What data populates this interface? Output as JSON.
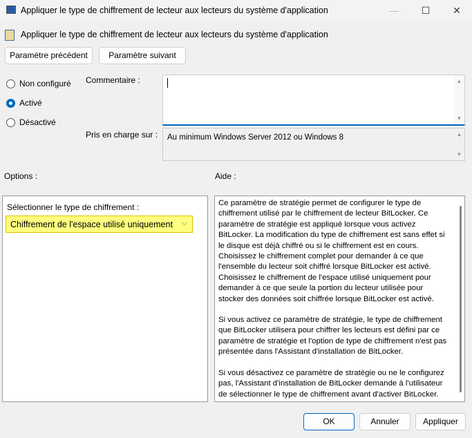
{
  "window": {
    "title": "Appliquer le type de chiffrement de lecteur aux lecteurs du système d'application",
    "minimize": "—",
    "maximize": "☐",
    "close": "✕"
  },
  "header": {
    "title": "Appliquer le type de chiffrement de lecteur aux lecteurs du système d'application"
  },
  "nav": {
    "previous": "Paramètre précédent",
    "next": "Paramètre suivant"
  },
  "state": {
    "options": [
      {
        "label": "Non configuré",
        "selected": false
      },
      {
        "label": "Activé",
        "selected": true
      },
      {
        "label": "Désactivé",
        "selected": false
      }
    ]
  },
  "comment": {
    "label": "Commentaire :",
    "value": ""
  },
  "supported": {
    "label": "Pris en charge sur :",
    "value": "Au minimum Windows Server 2012 ou Windows 8"
  },
  "options": {
    "label": "Options :",
    "select_label": "Sélectionner le type de chiffrement :",
    "select_value": "Chiffrement de l'espace utilisé uniquement"
  },
  "help": {
    "label": "Aide :",
    "paragraphs": [
      "Ce paramètre de stratégie permet de configurer le type de chiffrement utilisé par le chiffrement de lecteur BitLocker. Ce paramètre de stratégie est appliqué lorsque vous activez BitLocker. La modification du type de chiffrement est sans effet si le disque est déjà chiffré ou si le chiffrement est en cours. Choisissez le chiffrement complet pour demander à ce que l'ensemble du lecteur soit chiffré lorsque BitLocker est activé. Choisissez le chiffrement de l'espace utilisé uniquement pour demander à ce que seule la portion du lecteur utilisée pour stocker des données soit chiffrée lorsque BitLocker est activé.",
      "Si vous activez ce paramètre de stratégie, le type de chiffrement que BitLocker utilisera pour chiffrer les lecteurs est défini par ce paramètre de stratégie et l'option de type de chiffrement n'est pas présentée dans l'Assistant d'installation de BitLocker.",
      "Si vous désactivez ce paramètre de stratégie ou ne le configurez pas, l'Assistant d'installation de BitLocker demande à l'utilisateur de sélectionner le type de chiffrement avant d'activer BitLocker."
    ]
  },
  "footer": {
    "ok": "OK",
    "cancel": "Annuler",
    "apply": "Appliquer"
  },
  "colors": {
    "accent": "#0067c0",
    "highlight": "#ffff80"
  }
}
